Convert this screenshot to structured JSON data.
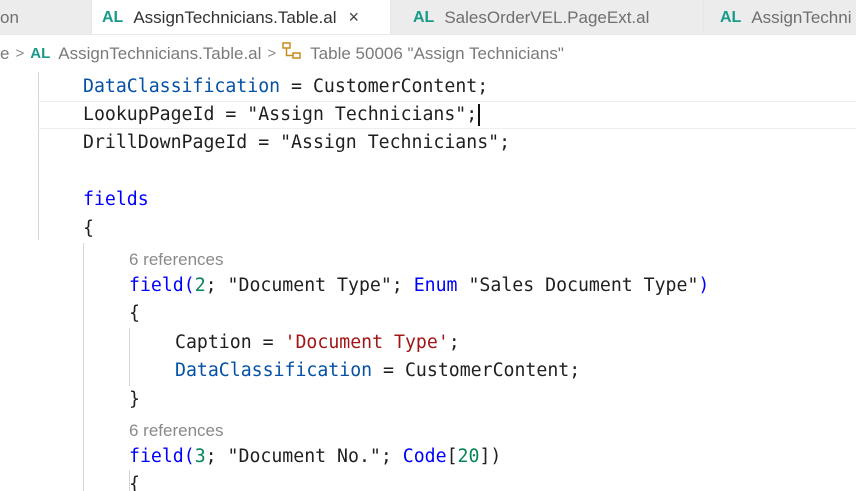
{
  "tabs": [
    {
      "badge": "",
      "label": "on"
    },
    {
      "badge": "AL",
      "label": "AssignTechnicians.Table.al",
      "close": "×"
    },
    {
      "badge": "AL",
      "label": "SalesOrderVEL.PageExt.al"
    },
    {
      "badge": "AL",
      "label": "AssignTechni"
    }
  ],
  "breadcrumb": {
    "partial_prefix": "e",
    "separator": ">",
    "file_badge": "AL",
    "file_name": "AssignTechnicians.Table.al",
    "symbol_label": "Table 50006 \"Assign Technicians\""
  },
  "code": {
    "line1": {
      "prop": "DataClassification",
      "op": " = ",
      "value": "CustomerContent;"
    },
    "line2": {
      "prop": "LookupPageId",
      "op": " = ",
      "value": "\"Assign Technicians\";"
    },
    "line3": {
      "prop": "DrillDownPageId",
      "op": " = ",
      "value": "\"Assign Technicians\";"
    },
    "fields_kw": "fields",
    "open_brace": "{",
    "close_brace": "}",
    "lens1": "6 references",
    "field1": {
      "kw": "field(",
      "num": "2",
      "rest1": "; \"Document Type\"; ",
      "enum_kw": "Enum",
      "rest2": " \"Sales Document Type\"",
      "close_paren": ")"
    },
    "caption": {
      "prop": "Caption",
      "op": " = ",
      "str": "'Document Type'",
      "semi": ";"
    },
    "dataclass": {
      "prop": "DataClassification",
      "op": " = ",
      "value": "CustomerContent;"
    },
    "lens2": "6 references",
    "field2": {
      "kw": "field(",
      "num": "3",
      "rest1": "; \"Document No.\"; ",
      "type_kw": "Code",
      "bracket_open": "[",
      "num2": "20",
      "bracket_close": "])"
    }
  }
}
